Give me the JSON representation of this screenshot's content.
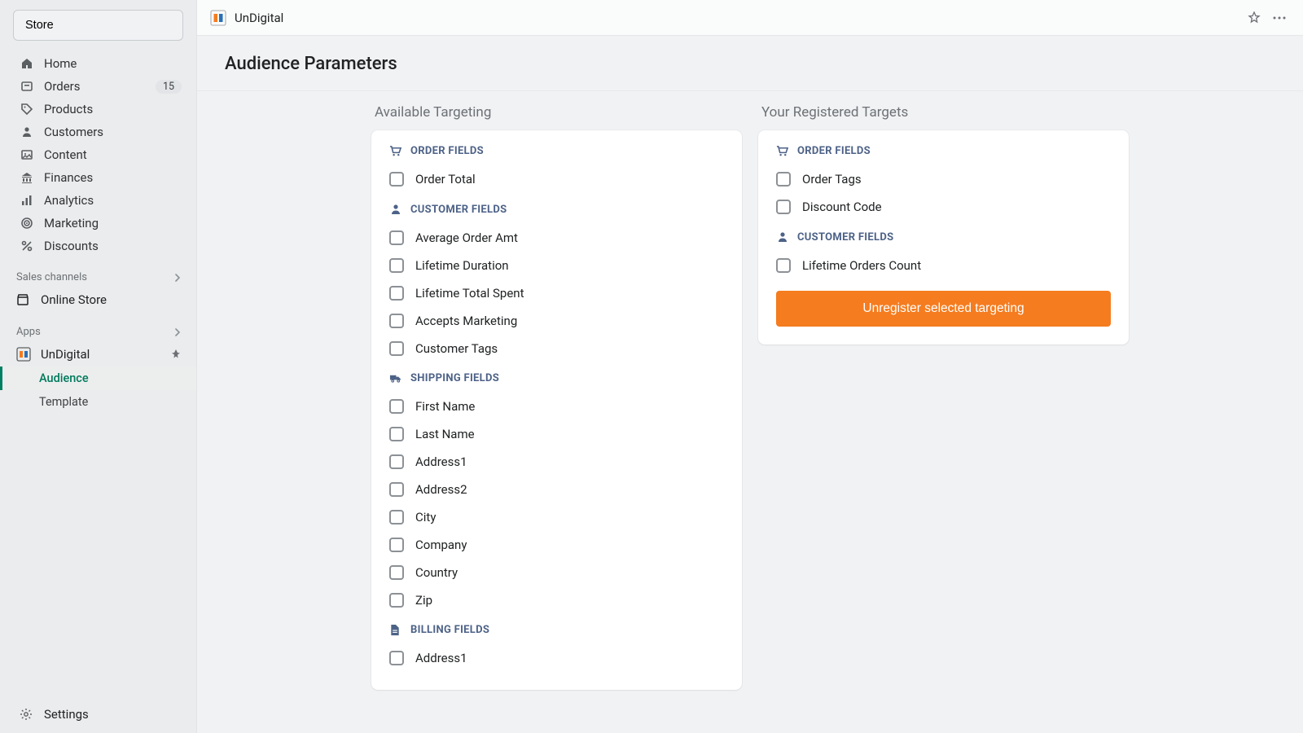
{
  "sidebar": {
    "store_button": "Store",
    "nav": [
      {
        "label": "Home",
        "icon": "home"
      },
      {
        "label": "Orders",
        "icon": "orders",
        "badge": "15"
      },
      {
        "label": "Products",
        "icon": "tag"
      },
      {
        "label": "Customers",
        "icon": "user"
      },
      {
        "label": "Content",
        "icon": "image"
      },
      {
        "label": "Finances",
        "icon": "bank"
      },
      {
        "label": "Analytics",
        "icon": "bars"
      },
      {
        "label": "Marketing",
        "icon": "target"
      },
      {
        "label": "Discounts",
        "icon": "percent"
      }
    ],
    "sales_channels_label": "Sales channels",
    "online_store_label": "Online Store",
    "apps_label": "Apps",
    "app_name": "UnDigital",
    "sub_nav": [
      {
        "label": "Audience",
        "active": true
      },
      {
        "label": "Template",
        "active": false
      }
    ],
    "settings_label": "Settings"
  },
  "topbar": {
    "app_title": "UnDigital"
  },
  "page_title": "Audience Parameters",
  "columns": {
    "available": {
      "title": "Available Targeting",
      "groups": [
        {
          "icon": "cart",
          "heading": "ORDER FIELDS",
          "items": [
            "Order Total"
          ]
        },
        {
          "icon": "user",
          "heading": "CUSTOMER FIELDS",
          "items": [
            "Average Order Amt",
            "Lifetime Duration",
            "Lifetime Total Spent",
            "Accepts Marketing",
            "Customer Tags"
          ]
        },
        {
          "icon": "truck",
          "heading": "SHIPPING FIELDS",
          "items": [
            "First Name",
            "Last Name",
            "Address1",
            "Address2",
            "City",
            "Company",
            "Country",
            "Zip"
          ]
        },
        {
          "icon": "file",
          "heading": "BILLING FIELDS",
          "items": [
            "Address1"
          ]
        }
      ]
    },
    "registered": {
      "title": "Your Registered Targets",
      "groups": [
        {
          "icon": "cart",
          "heading": "ORDER FIELDS",
          "items": [
            "Order Tags",
            "Discount Code"
          ]
        },
        {
          "icon": "user",
          "heading": "CUSTOMER FIELDS",
          "items": [
            "Lifetime Orders Count"
          ]
        }
      ],
      "action_button": "Unregister selected targeting"
    }
  }
}
